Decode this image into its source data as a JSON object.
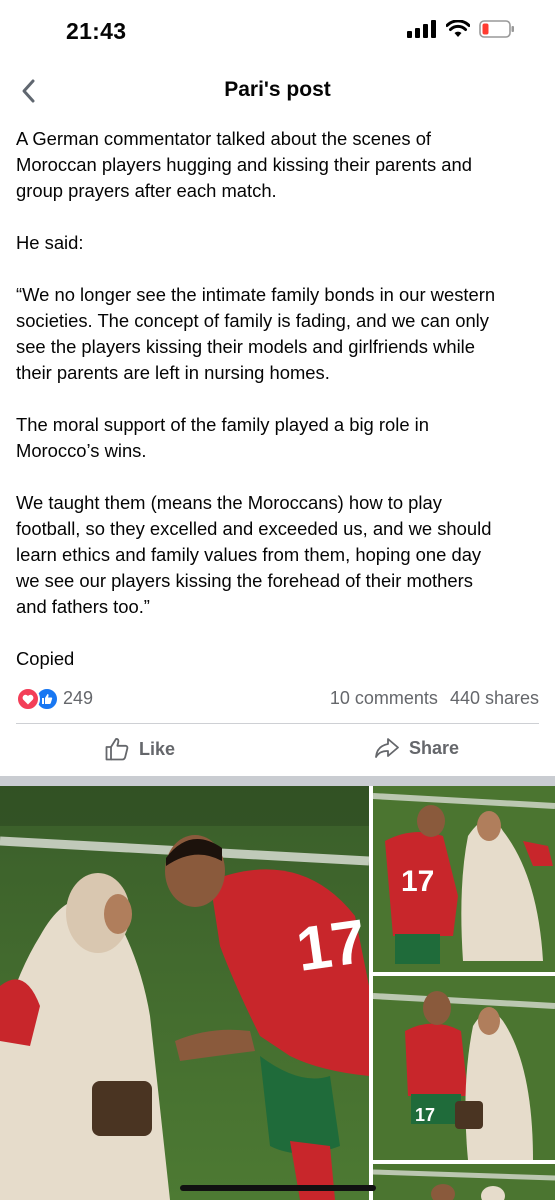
{
  "status_bar": {
    "time": "21:43",
    "signal_icon": "cellular-signal-icon",
    "wifi_icon": "wifi-icon",
    "battery_icon": "battery-low-icon",
    "battery_color": "#ff3b30"
  },
  "nav": {
    "back_icon": "chevron-left-icon",
    "title": "Pari's post"
  },
  "post": {
    "paragraphs": [
      "A German commentator talked about the scenes of\nMoroccan players hugging and kissing their parents and\ngroup prayers after each match.",
      "He said:",
      "“We no longer see the intimate family bonds in our western\nsocieties.  The concept of family is fading, and we can only\nsee the players kissing their models and girlfriends while\ntheir parents are left in nursing homes.",
      "The moral support of the family played a big role in\nMorocco’s wins.",
      "We taught them (means the Moroccans) how to play\nfootball, so they excelled and exceeded us, and we should\nlearn ethics and family values from them, hoping one day\nwe see our players kissing the forehead of their mothers\nand fathers too.”",
      "Copied"
    ]
  },
  "engagement": {
    "reaction_icons": [
      "love-reaction-icon",
      "like-reaction-icon"
    ],
    "reaction_count": "249",
    "comments": "10 comments",
    "shares": "440 shares"
  },
  "actions": {
    "like_label": "Like",
    "like_icon": "thumbs-up-icon",
    "share_label": "Share",
    "share_icon": "share-arrow-icon"
  },
  "colors": {
    "text": "#050505",
    "secondary_text": "#65676b",
    "divider": "#ced0d4",
    "like_blue": "#1877f2",
    "love_red": "#f33e58",
    "jersey_red": "#c8262b",
    "jersey_green": "#1f6b3a",
    "pitch_green": "#3f6d2c"
  },
  "photos": [
    {
      "name": "main-photo"
    },
    {
      "name": "side-photo-1"
    },
    {
      "name": "side-photo-2"
    },
    {
      "name": "side-photo-3"
    }
  ]
}
